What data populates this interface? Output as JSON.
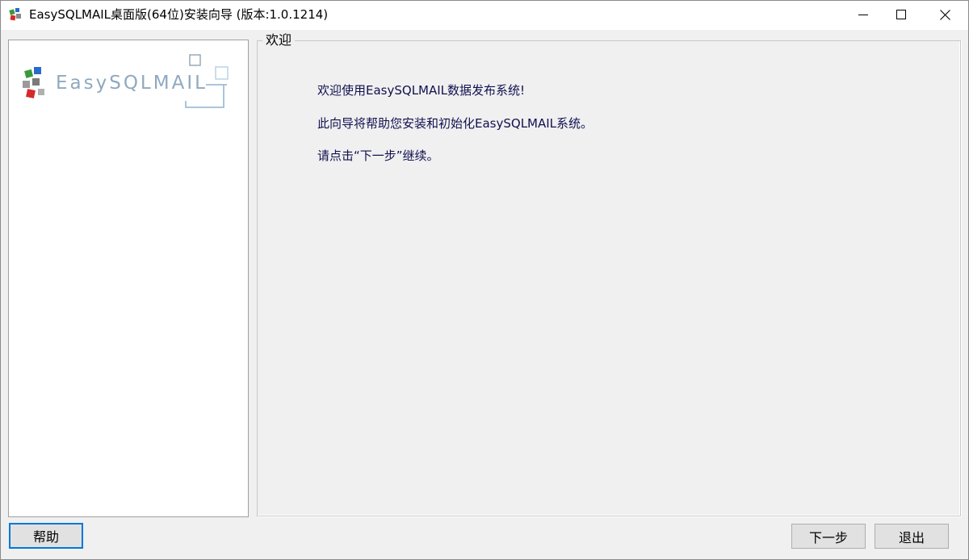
{
  "window": {
    "title": "EasySQLMAIL桌面版(64位)安装向导 (版本:1.0.1214)",
    "icon": "app-icon",
    "controls": [
      "minimize-icon",
      "maximize-icon",
      "close-icon"
    ]
  },
  "left_panel": {
    "logo_text": "EasySQLMAIL"
  },
  "welcome": {
    "group_title": "欢迎",
    "line1": "欢迎使用EasySQLMAIL数据发布系统!",
    "line2": "此向导将帮助您安装和初始化EasySQLMAIL系统。",
    "line3": "请点击“下一步”继续。"
  },
  "buttons": {
    "help": "帮助",
    "next": "下一步",
    "exit": "退出"
  },
  "colors": {
    "text_accent": "#101050",
    "default_button_border": "#0078d7",
    "logo_text": "#8fa9bf"
  }
}
